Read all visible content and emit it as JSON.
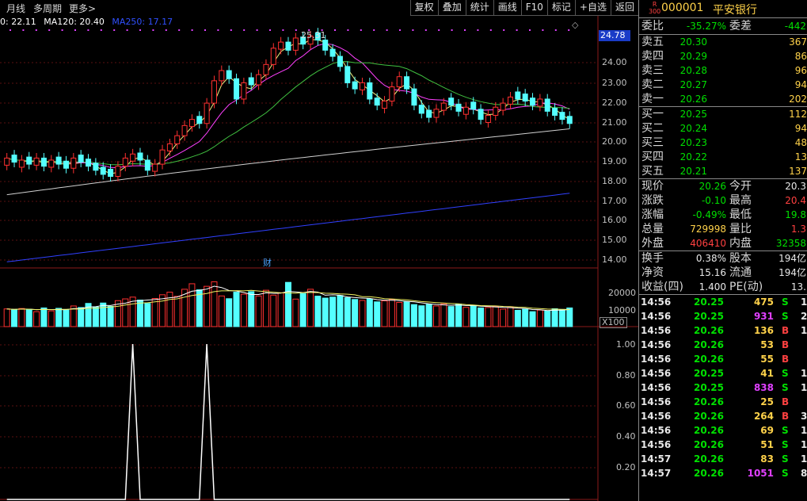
{
  "toolbar": {
    "left": [
      "月线",
      "多周期",
      "更多>"
    ],
    "right": [
      "复权",
      "叠加",
      "统计",
      "画线",
      "F10",
      "标记",
      "+自选",
      "返回"
    ]
  },
  "ma_legend": [
    {
      "text": "0: 22.11",
      "color": "#ffffff"
    },
    {
      "text": "MA120: 20.40",
      "color": "#ffffff"
    },
    {
      "text": "MA250: 17.17",
      "color": "#3050ff"
    }
  ],
  "chart": {
    "price_box": "24.78",
    "high_label": "25.31",
    "event_label": "财",
    "price_ticks": [
      "24.00",
      "23.00",
      "22.00",
      "21.00",
      "20.00",
      "19.00",
      "18.00",
      "17.00",
      "16.00",
      "15.00",
      "14.00"
    ],
    "vol_ticks": [
      "20000",
      "10000"
    ],
    "vol_unit": "X100",
    "ind_ticks": [
      "1.00",
      "0.80",
      "0.60",
      "0.40",
      "0.20"
    ]
  },
  "chart_data": {
    "type": "bar",
    "price_range": [
      13.5,
      25.5
    ],
    "candles_close": [
      18.9,
      18.7,
      18.8,
      18.6,
      18.9,
      18.5,
      18.8,
      18.6,
      18.4,
      18.9,
      18.7,
      18.5,
      18.3,
      18.1,
      18.0,
      18.5,
      18.9,
      19.1,
      18.8,
      18.3,
      18.6,
      19.3,
      19.6,
      20.0,
      20.5,
      20.8,
      20.6,
      21.6,
      22.7,
      23.2,
      22.8,
      21.8,
      22.6,
      22.5,
      23.0,
      23.5,
      24.3,
      24.6,
      24.2,
      24.8,
      24.5,
      24.9,
      24.7,
      24.2,
      23.9,
      23.4,
      22.6,
      22.3,
      22.6,
      21.8,
      21.5,
      21.7,
      22.4,
      22.9,
      22.3,
      21.5,
      21.1,
      20.9,
      21.3,
      21.6,
      21.5,
      21.2,
      21.4,
      21.3,
      20.8,
      21.0,
      21.4,
      21.6,
      21.9,
      21.8,
      21.7,
      21.5,
      21.8,
      21.2,
      21.0,
      20.8,
      20.6
    ],
    "candle_up": [
      1,
      0,
      1,
      0,
      1,
      0,
      1,
      0,
      0,
      1,
      0,
      0,
      0,
      0,
      0,
      1,
      1,
      1,
      0,
      0,
      1,
      1,
      1,
      1,
      1,
      1,
      0,
      1,
      1,
      1,
      0,
      0,
      1,
      0,
      1,
      1,
      1,
      1,
      0,
      1,
      0,
      1,
      0,
      0,
      0,
      0,
      0,
      0,
      1,
      0,
      0,
      1,
      1,
      1,
      0,
      0,
      0,
      0,
      1,
      1,
      0,
      0,
      1,
      0,
      0,
      1,
      1,
      1,
      1,
      0,
      0,
      0,
      1,
      0,
      0,
      0,
      0
    ],
    "volume": [
      9000,
      8500,
      9200,
      8800,
      7600,
      9500,
      8000,
      9300,
      8700,
      10500,
      9700,
      11800,
      9900,
      12000,
      10300,
      13200,
      14100,
      15000,
      13500,
      11800,
      14300,
      16200,
      17500,
      15400,
      19000,
      21800,
      18700,
      20500,
      22800,
      15600,
      14200,
      17500,
      16500,
      17800,
      15600,
      18500,
      16000,
      17200,
      22500,
      14000,
      16800,
      19000,
      15500,
      14500,
      15000,
      15800,
      14700,
      13800,
      13300,
      14100,
      12600,
      13100,
      13800,
      12300,
      12600,
      11200,
      10600,
      11300,
      10500,
      11600,
      10200,
      11500,
      9800,
      10800,
      9500,
      9700,
      10300,
      8900,
      9800,
      8300,
      8800,
      7600,
      8400,
      7900,
      9100,
      8700,
      9500
    ],
    "ma250": [
      13.8,
      17.17
    ],
    "indicator": {
      "spikes_at": [
        17,
        27
      ],
      "value": 1.0
    }
  },
  "quote": {
    "r_badge": [
      "R",
      "300"
    ],
    "code": "000001",
    "name": "平安银行",
    "ratio": {
      "l": "委比",
      "v": "-35.27%",
      "l2": "委差",
      "v2": "-442"
    },
    "sells": [
      {
        "l": "卖五",
        "p": "20.30",
        "v": "367"
      },
      {
        "l": "卖四",
        "p": "20.29",
        "v": "86"
      },
      {
        "l": "卖三",
        "p": "20.28",
        "v": "96"
      },
      {
        "l": "卖二",
        "p": "20.27",
        "v": "94"
      },
      {
        "l": "卖一",
        "p": "20.26",
        "v": "202"
      }
    ],
    "buys": [
      {
        "l": "买一",
        "p": "20.25",
        "v": "112"
      },
      {
        "l": "买二",
        "p": "20.24",
        "v": "94"
      },
      {
        "l": "买三",
        "p": "20.23",
        "v": "48"
      },
      {
        "l": "买四",
        "p": "20.22",
        "v": "13"
      },
      {
        "l": "买五",
        "p": "20.21",
        "v": "137"
      }
    ],
    "stats": [
      {
        "l": "现价",
        "v": "20.26",
        "vc": "green",
        "l2": "今开",
        "v2": "20.3",
        "v2c": "white"
      },
      {
        "l": "涨跌",
        "v": "-0.10",
        "vc": "green",
        "l2": "最高",
        "v2": "20.4",
        "v2c": "red"
      },
      {
        "l": "涨幅",
        "v": "-0.49%",
        "vc": "green",
        "l2": "最低",
        "v2": "19.8",
        "v2c": "green"
      },
      {
        "l": "总量",
        "v": "729998",
        "vc": "yellow",
        "l2": "量比",
        "v2": "1.3",
        "v2c": "red"
      },
      {
        "l": "外盘",
        "v": "406410",
        "vc": "red",
        "l2": "内盘",
        "v2": "32358",
        "v2c": "green"
      }
    ],
    "info": [
      {
        "l": "换手",
        "v": "0.38%",
        "l2": "股本",
        "v2": "194亿"
      },
      {
        "l": "净资",
        "v": "15.16",
        "l2": "流通",
        "v2": "194亿"
      },
      {
        "l": "收益(四)",
        "v": "1.400",
        "l2": "PE(动)",
        "v2": "13."
      }
    ],
    "ticks": [
      {
        "t": "14:56",
        "p": "20.25",
        "pc": "green",
        "q": "475",
        "qc": "yellow",
        "d": "S",
        "dc": "green",
        "x": "1"
      },
      {
        "t": "14:56",
        "p": "20.25",
        "pc": "green",
        "q": "931",
        "qc": "magenta",
        "d": "S",
        "dc": "green",
        "x": "2"
      },
      {
        "t": "14:56",
        "p": "20.26",
        "pc": "green",
        "q": "136",
        "qc": "yellow",
        "d": "B",
        "dc": "red",
        "x": "1"
      },
      {
        "t": "14:56",
        "p": "20.26",
        "pc": "green",
        "q": "53",
        "qc": "yellow",
        "d": "B",
        "dc": "red",
        "x": ""
      },
      {
        "t": "14:56",
        "p": "20.26",
        "pc": "green",
        "q": "55",
        "qc": "yellow",
        "d": "B",
        "dc": "red",
        "x": ""
      },
      {
        "t": "14:56",
        "p": "20.25",
        "pc": "green",
        "q": "41",
        "qc": "yellow",
        "d": "S",
        "dc": "green",
        "x": "1"
      },
      {
        "t": "14:56",
        "p": "20.25",
        "pc": "green",
        "q": "838",
        "qc": "magenta",
        "d": "S",
        "dc": "green",
        "x": "1"
      },
      {
        "t": "14:56",
        "p": "20.26",
        "pc": "green",
        "q": "25",
        "qc": "yellow",
        "d": "B",
        "dc": "red",
        "x": ""
      },
      {
        "t": "14:56",
        "p": "20.26",
        "pc": "green",
        "q": "264",
        "qc": "yellow",
        "d": "B",
        "dc": "red",
        "x": "3"
      },
      {
        "t": "14:56",
        "p": "20.26",
        "pc": "green",
        "q": "69",
        "qc": "yellow",
        "d": "S",
        "dc": "green",
        "x": "1"
      },
      {
        "t": "14:56",
        "p": "20.26",
        "pc": "green",
        "q": "51",
        "qc": "yellow",
        "d": "S",
        "dc": "green",
        "x": "1"
      },
      {
        "t": "14:57",
        "p": "20.26",
        "pc": "green",
        "q": "83",
        "qc": "yellow",
        "d": "S",
        "dc": "green",
        "x": "1"
      },
      {
        "t": "14:57",
        "p": "20.26",
        "pc": "green",
        "q": "1051",
        "qc": "magenta",
        "d": "S",
        "dc": "green",
        "x": "8"
      }
    ]
  }
}
